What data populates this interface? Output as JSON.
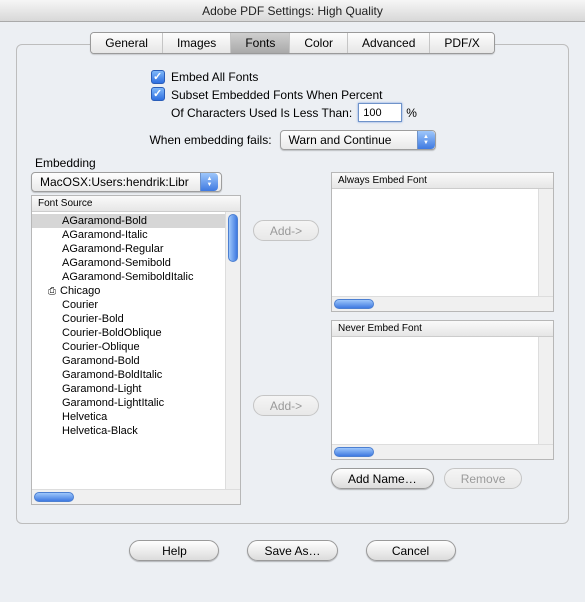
{
  "title": "Adobe PDF Settings: High Quality",
  "tabs": [
    "General",
    "Images",
    "Fonts",
    "Color",
    "Advanced",
    "PDF/X"
  ],
  "selected_tab": "Fonts",
  "embed_all_label": "Embed All Fonts",
  "subset_label_line1": "Subset Embedded Fonts When Percent",
  "subset_label_line2": "Of Characters Used Is Less Than:",
  "subset_value": "100",
  "percent_sign": "%",
  "fail_label": "When embedding fails:",
  "fail_value": "Warn and Continue",
  "embedding_group_label": "Embedding",
  "path_select": "MacOSX:Users:hendrik:Libr",
  "font_source_header": "Font Source",
  "fonts": [
    {
      "name": "AGaramond-Bold",
      "selected": true
    },
    {
      "name": "AGaramond-Italic"
    },
    {
      "name": "AGaramond-Regular"
    },
    {
      "name": "AGaramond-Semibold"
    },
    {
      "name": "AGaramond-SemiboldItalic"
    },
    {
      "name": "Chicago",
      "printer": true
    },
    {
      "name": "Courier"
    },
    {
      "name": "Courier-Bold"
    },
    {
      "name": "Courier-BoldOblique"
    },
    {
      "name": "Courier-Oblique"
    },
    {
      "name": "Garamond-Bold"
    },
    {
      "name": "Garamond-BoldItalic"
    },
    {
      "name": "Garamond-Light"
    },
    {
      "name": "Garamond-LightItalic"
    },
    {
      "name": "Helvetica"
    },
    {
      "name": "Helvetica-Black"
    }
  ],
  "add_btn": "Add->",
  "always_header": "Always Embed Font",
  "never_header": "Never Embed Font",
  "add_name_btn": "Add Name…",
  "remove_btn": "Remove",
  "help_btn": "Help",
  "saveas_btn": "Save As…",
  "cancel_btn": "Cancel"
}
